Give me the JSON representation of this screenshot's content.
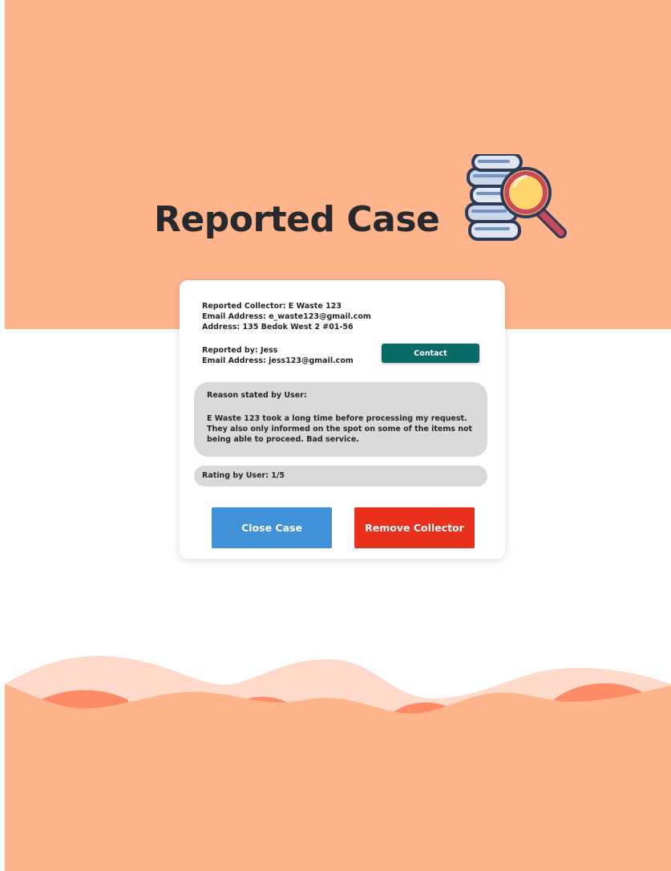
{
  "header": {
    "title": "Reported Case"
  },
  "colors": {
    "band": "#ffb48c",
    "wave_light": "#ffd9c9",
    "wave_accent": "#ff8b66",
    "contact": "#0b6a67",
    "close_case": "#4092d8",
    "remove_collector": "#e8301c"
  },
  "illustration": {
    "icon": "documents-magnifier-icon"
  },
  "collector": {
    "name_line": "Reported Collector: E Waste 123",
    "email_line": "Email Address: e_waste123@gmail.com",
    "address_line": "Address: 135 Bedok West 2 #01-56"
  },
  "reporter": {
    "name_line": "Reported by: Jess",
    "email_line": "Email Address: jess123@gmail.com",
    "contact_label": "Contact"
  },
  "reason": {
    "heading": "Reason stated by User:",
    "text": "E Waste 123 took a long time before processing my request. They also only informed on the spot on some of the items not being able to proceed. Bad service."
  },
  "rating": {
    "text": "Rating by User: 1/5"
  },
  "actions": {
    "close_case_label": "Close Case",
    "remove_collector_label": "Remove Collector"
  }
}
